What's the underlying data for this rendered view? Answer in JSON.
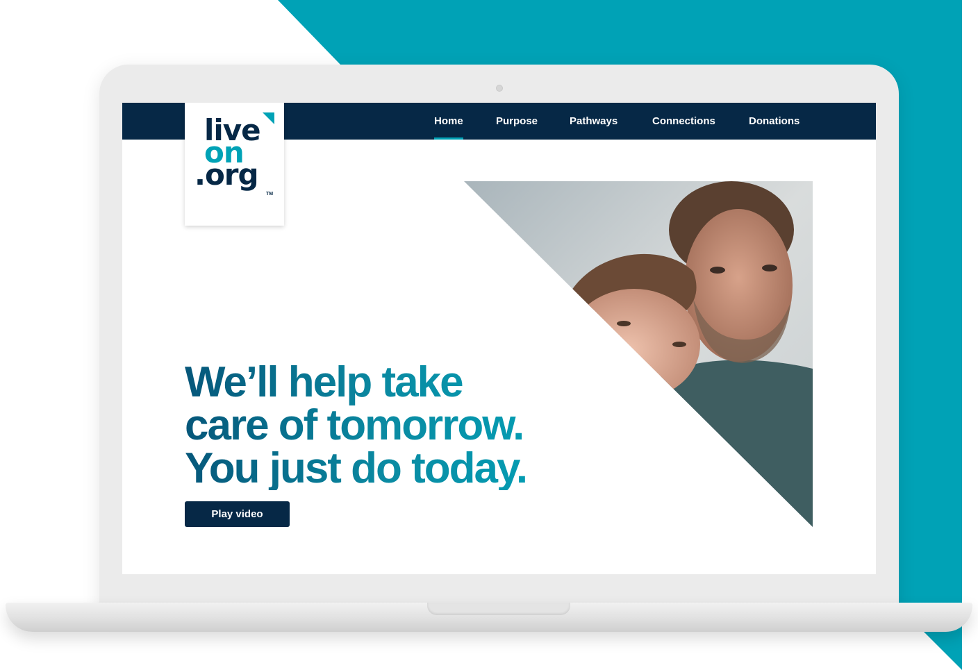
{
  "brand": {
    "logo_lines": [
      "live",
      "on",
      ".org"
    ],
    "trademark": "TM"
  },
  "nav": {
    "items": [
      {
        "label": "Home",
        "active": true
      },
      {
        "label": "Purpose",
        "active": false
      },
      {
        "label": "Pathways",
        "active": false
      },
      {
        "label": "Connections",
        "active": false
      },
      {
        "label": "Donations",
        "active": false
      }
    ]
  },
  "hero": {
    "headline_lines": [
      "We’ll help take",
      "care of tomorrow.",
      "You just do today."
    ],
    "cta_label": "Play video"
  },
  "colors": {
    "navy": "#062846",
    "teal": "#00a2b6",
    "background_shape": "#00a2b6"
  }
}
